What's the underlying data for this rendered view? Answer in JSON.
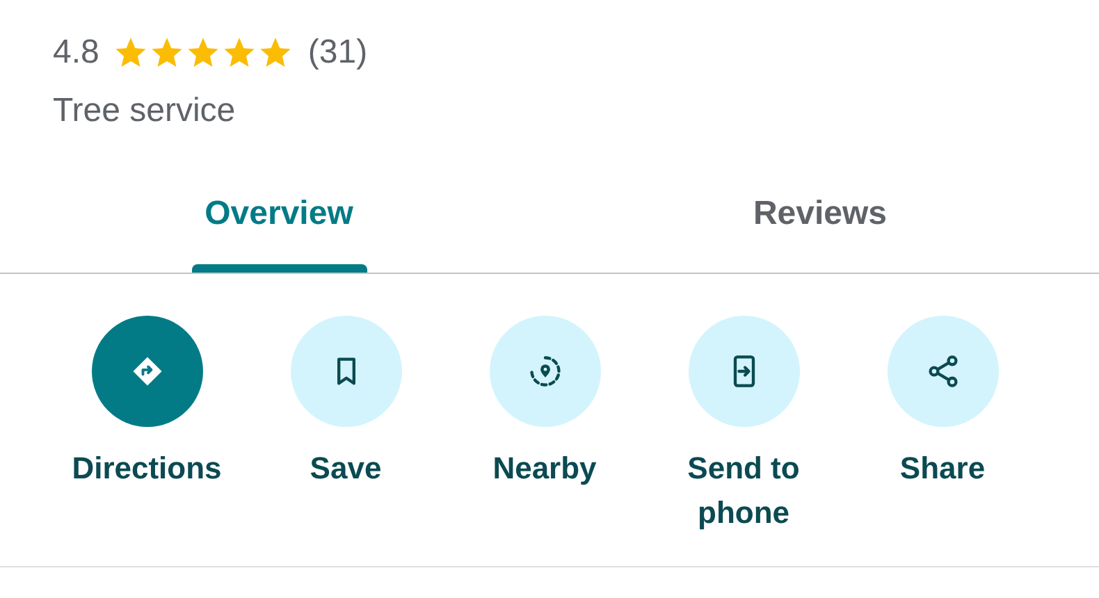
{
  "rating": {
    "score": "4.8",
    "stars": 5,
    "count": "(31)"
  },
  "category": "Tree service",
  "tabs": [
    {
      "label": "Overview",
      "selected": true
    },
    {
      "label": "Reviews",
      "selected": false
    }
  ],
  "actions": [
    {
      "label": "Directions",
      "kind": "primary"
    },
    {
      "label": "Save",
      "kind": "secondary"
    },
    {
      "label": "Nearby",
      "kind": "secondary"
    },
    {
      "label": "Send to phone",
      "kind": "secondary"
    },
    {
      "label": "Share",
      "kind": "secondary"
    }
  ]
}
